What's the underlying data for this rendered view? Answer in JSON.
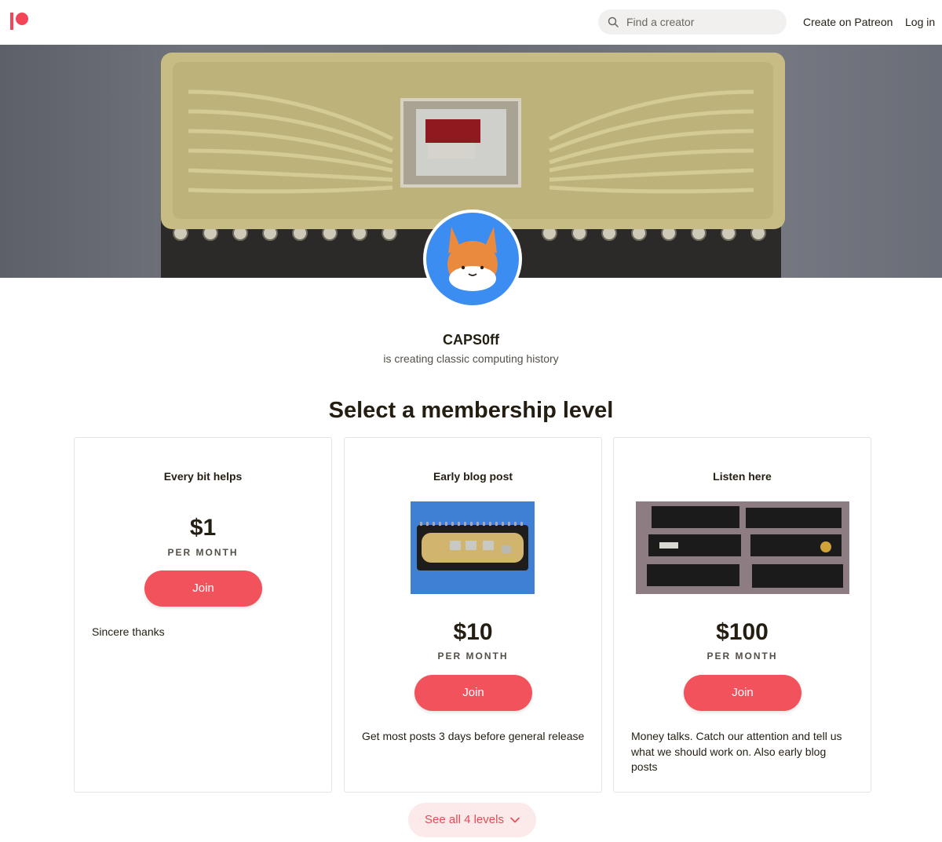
{
  "header": {
    "search_placeholder": "Find a creator",
    "create_link": "Create on Patreon",
    "login_link": "Log in"
  },
  "creator": {
    "name": "CAPS0ff",
    "tagline": "is creating classic computing history"
  },
  "section_title": "Select a membership level",
  "tiers": [
    {
      "title": "Every bit helps",
      "price": "$1",
      "period": "PER MONTH",
      "join_label": "Join",
      "description": "Sincere thanks"
    },
    {
      "title": "Early blog post",
      "price": "$10",
      "period": "PER MONTH",
      "join_label": "Join",
      "description": "Get most posts 3 days before general release"
    },
    {
      "title": "Listen here",
      "price": "$100",
      "period": "PER MONTH",
      "join_label": "Join",
      "description": "Money talks.  Catch our attention and tell us what we should work on.  Also early blog posts"
    }
  ],
  "see_all_label": "See all 4 levels",
  "colors": {
    "brand": "#f1465a",
    "join_button": "#f1525c",
    "see_all_bg": "#fce9ea",
    "avatar_bg": "#3b8df2"
  },
  "icons": [
    "patreon-logo",
    "search-icon",
    "chevron-down-icon"
  ]
}
